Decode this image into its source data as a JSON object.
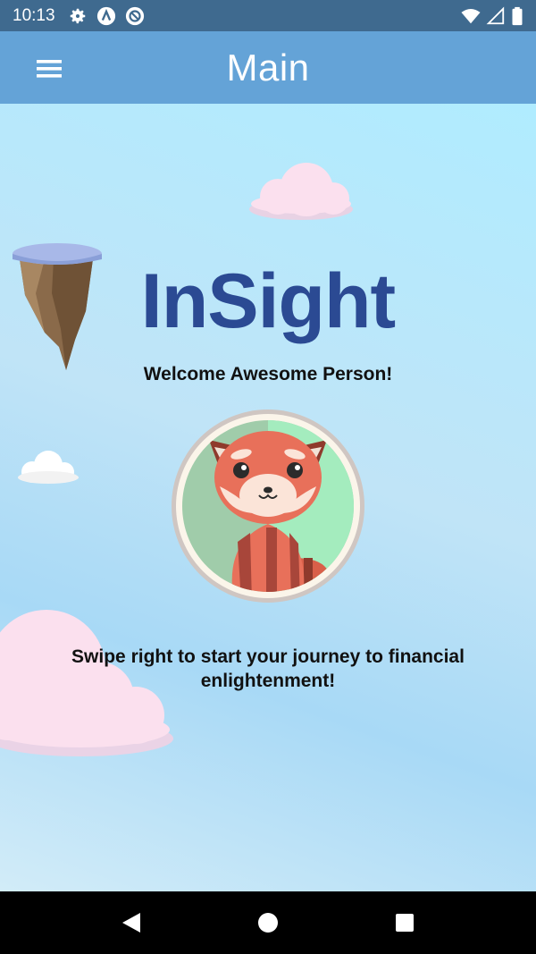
{
  "status_bar": {
    "time": "10:13",
    "icons": [
      "gear-icon",
      "app-a-icon",
      "no-disturb-icon",
      "wifi-icon",
      "signal-icon",
      "battery-icon"
    ]
  },
  "app_bar": {
    "title": "Main",
    "menu_icon": "hamburger-menu-icon"
  },
  "main": {
    "brand": "InSight",
    "welcome": "Welcome Awesome Person!",
    "swipe_hint": "Swipe right to start your journey to financial enlightenment!",
    "avatar": "red-panda-avatar"
  },
  "nav_bar": {
    "back_icon": "back-triangle-icon",
    "home_icon": "home-circle-icon",
    "recents_icon": "recents-square-icon"
  },
  "colors": {
    "status_bar": "#3f6a8f",
    "app_bar": "#64a3d7",
    "brand": "#2b4a93",
    "background": "#b8e6f8"
  }
}
